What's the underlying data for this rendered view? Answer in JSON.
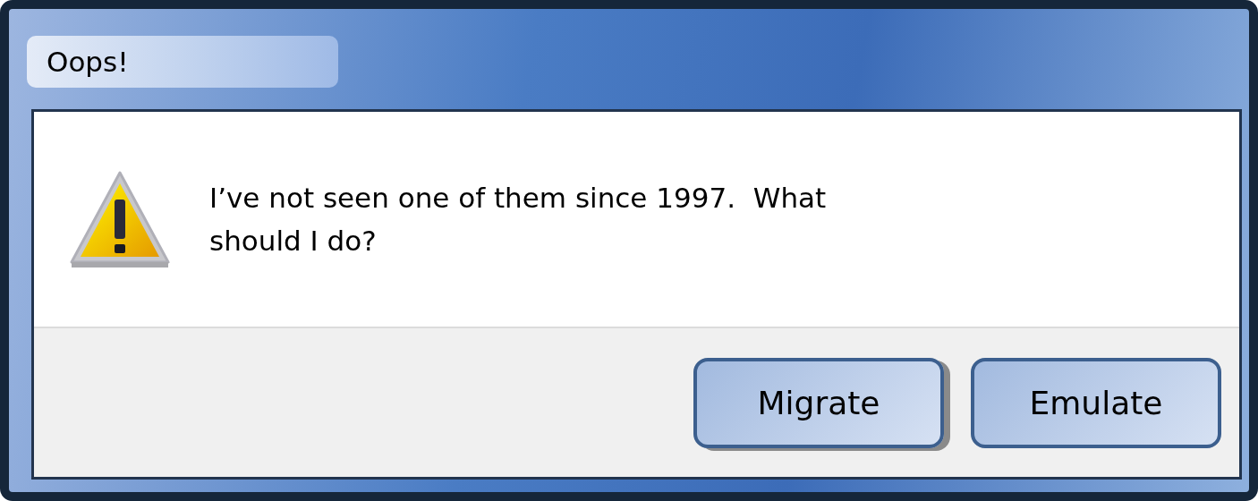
{
  "window": {
    "title": "Oops!"
  },
  "message": {
    "kind": "warning",
    "text": "I’ve not seen one of them since 1997.  What should I do?"
  },
  "buttons": [
    {
      "label": "Migrate",
      "focused": true
    },
    {
      "label": "Emulate",
      "focused": false
    }
  ]
}
